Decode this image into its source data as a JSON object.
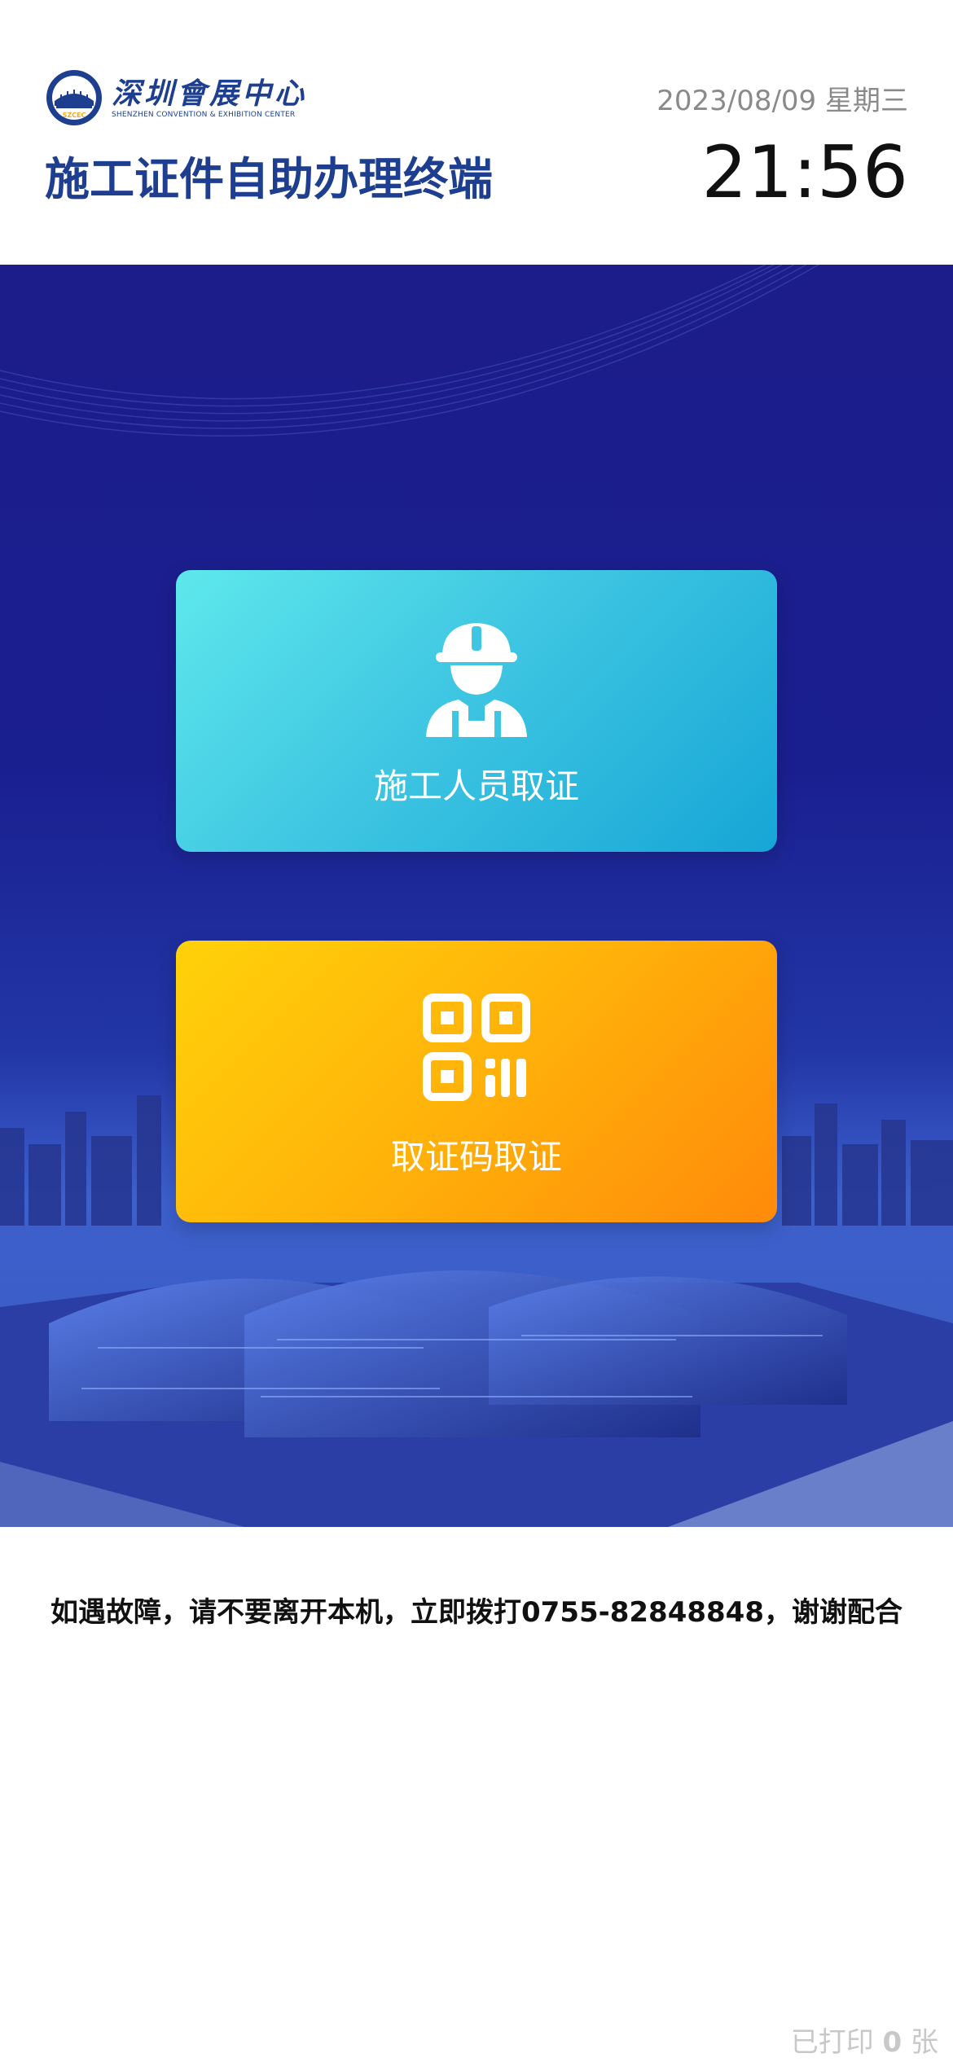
{
  "header": {
    "logo_cn": "深圳會展中心",
    "logo_en": "SHENZHEN CONVENTION & EXHIBITION CENTER",
    "logo_badge": "SZCEC",
    "title": "施工证件自助办理终端",
    "date": "2023/08/09 星期三",
    "time": "21:56"
  },
  "cards": [
    {
      "label": "施工人员取证",
      "icon": "worker-helmet-icon"
    },
    {
      "label": "取证码取证",
      "icon": "qr-code-icon"
    }
  ],
  "notice": "如遇故障，请不要离开本机，立即拨打0755-82848848，谢谢配合",
  "print_status": {
    "prefix": "已打印",
    "count": "0",
    "unit": "张"
  },
  "colors": {
    "brand_blue": "#1e3f8f",
    "hero_bg": "#1c1c8a",
    "worker_card": "#3fc6e2",
    "qr_card": "#ffb20a"
  }
}
